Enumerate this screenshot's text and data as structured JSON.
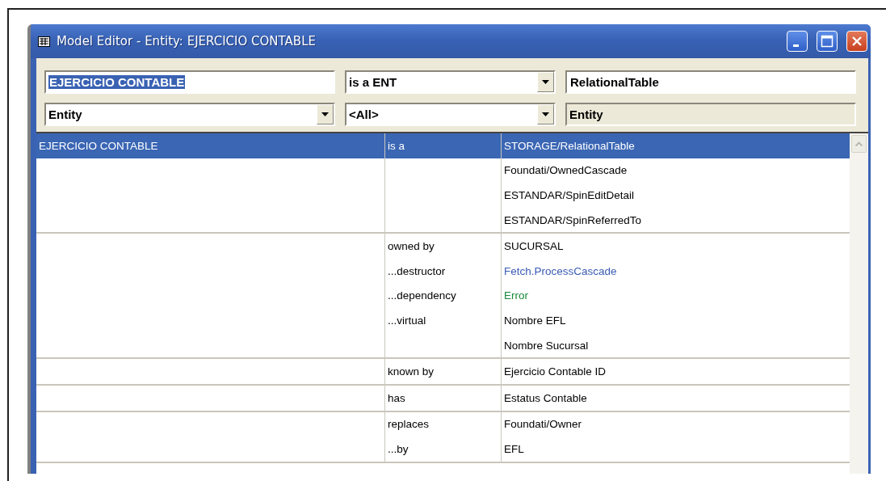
{
  "window": {
    "title": "Model Editor - Entity: EJERCICIO CONTABLE"
  },
  "controls": [
    {
      "kind": "field",
      "value": "EJERCICIO CONTABLE",
      "text_selected": true
    },
    {
      "kind": "combo",
      "value": "is a ENT"
    },
    {
      "kind": "field",
      "value": "RelationalTable",
      "text_selected": false
    },
    {
      "kind": "combo",
      "value": "Entity"
    },
    {
      "kind": "combo",
      "value": "<All>"
    },
    {
      "kind": "label",
      "value": "Entity"
    }
  ],
  "groups": [
    {
      "entity": "EJERCICIO CONTABLE",
      "lines": [
        {
          "relation": "is a",
          "value": "STORAGE/RelationalTable",
          "kind": "normal",
          "selected": true
        },
        {
          "value": "Foundati/OwnedCascade",
          "kind": "normal",
          "selected": false
        },
        {
          "value": "ESTANDAR/SpinEditDetail",
          "kind": "normal",
          "selected": false
        },
        {
          "value": "ESTANDAR/SpinReferredTo",
          "kind": "normal",
          "selected": false
        }
      ]
    },
    {
      "lines": [
        {
          "relation": "owned by",
          "value": "SUCURSAL",
          "kind": "normal",
          "selected": false
        },
        {
          "relation": "...destructor",
          "value": "Fetch.ProcessCascade",
          "kind": "link",
          "selected": false
        },
        {
          "relation": "...dependency",
          "value": "Error",
          "kind": "error",
          "selected": false
        },
        {
          "relation": "...virtual",
          "value": "Nombre EFL",
          "kind": "normal",
          "selected": false
        },
        {
          "value": "Nombre Sucursal",
          "kind": "normal",
          "selected": false
        }
      ]
    },
    {
      "lines": [
        {
          "relation": "known by",
          "value": "Ejercicio Contable ID",
          "kind": "normal",
          "selected": false
        }
      ]
    },
    {
      "lines": [
        {
          "relation": "has",
          "value": "Estatus Contable",
          "kind": "normal",
          "selected": false
        }
      ]
    },
    {
      "lines": [
        {
          "relation": "replaces",
          "value": "Foundati/Owner",
          "kind": "normal",
          "selected": false
        },
        {
          "relation": "...by",
          "value": "EFL",
          "kind": "normal",
          "selected": false
        }
      ]
    }
  ]
}
